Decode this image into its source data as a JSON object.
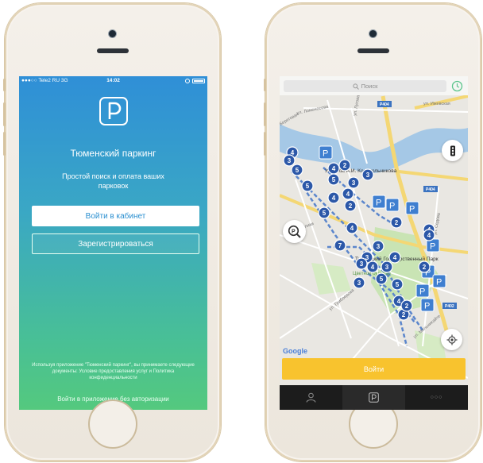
{
  "colors": {
    "login_gradient_top": "#2f8fd7",
    "login_gradient_bottom": "#54c97e",
    "marker_blue": "#2c58a8",
    "enter_button": "#f8c32e",
    "tab_bar": "#1c1c1c"
  },
  "login": {
    "status_bar": {
      "carrier": "●●●○○ Tele2 RU  3G",
      "time": "14:02"
    },
    "logo_icon": "parking-p-icon",
    "title": "Тюменский паркинг",
    "subtitle": "Простой поиск и оплата ваших парковок",
    "login_button": "Войти в кабинет",
    "register_button": "Зарегистрироваться",
    "disclaimer": "Используя приложение \"Тюменский паркинг\", вы принимаете следующие документы: Условие предоставления услуг и Политика конфиденциальности",
    "skip_link": "Войти в приложение без авторизации"
  },
  "map": {
    "search_placeholder": "Поиск",
    "history_icon": "clock-icon",
    "traffic_icon": "traffic-light-icon",
    "parking_search_icon": "parking-search-icon",
    "locate_icon": "locate-icon",
    "google_logo": "Google",
    "enter_button": "Войти",
    "tabs": [
      {
        "icon": "person-icon",
        "active": false
      },
      {
        "icon": "parking-p-icon",
        "active": true
      },
      {
        "icon": "more-dots-icon",
        "label": "○○○",
        "active": false
      }
    ],
    "labels": [
      "ул. Ломоносова",
      "Береговая",
      "ул. Луговая",
      "Р404",
      "ул. Ижевская",
      "Усадьба А.И. Колокольникова",
      "Тюменский Государственный Парк",
      "Цветной бульвар",
      "ул. Грибоедова",
      "ул. Седова",
      "Р402",
      "ул. Мельникайте",
      "ул. Республики"
    ],
    "markers": [
      {
        "n": "4"
      },
      {
        "n": "3"
      },
      {
        "n": "5"
      },
      {
        "n": "4"
      },
      {
        "n": "2"
      },
      {
        "n": "5"
      },
      {
        "n": "3"
      },
      {
        "n": "3"
      },
      {
        "n": "5"
      },
      {
        "n": "4"
      },
      {
        "n": "4"
      },
      {
        "n": "5"
      },
      {
        "n": "2"
      },
      {
        "n": "4"
      },
      {
        "n": "2"
      },
      {
        "n": "4"
      },
      {
        "n": "7"
      },
      {
        "n": "3"
      },
      {
        "n": "3"
      },
      {
        "n": "3"
      },
      {
        "n": "4"
      },
      {
        "n": "4"
      },
      {
        "n": "3"
      },
      {
        "n": "2"
      },
      {
        "n": "5"
      },
      {
        "n": "3"
      },
      {
        "n": "5"
      },
      {
        "n": "4"
      },
      {
        "n": "2"
      },
      {
        "n": "4"
      },
      {
        "n": "2"
      }
    ],
    "p_marker_label": "P"
  }
}
